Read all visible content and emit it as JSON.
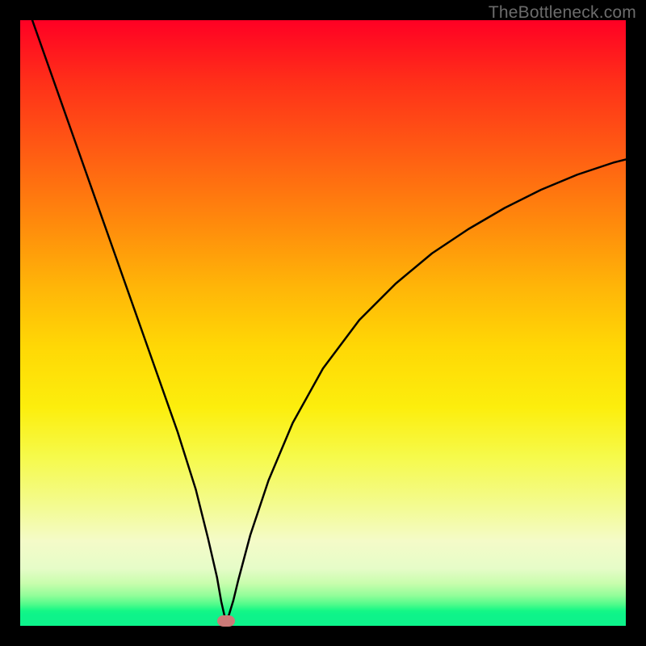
{
  "watermark": "TheBottleneck.com",
  "colors": {
    "curve_stroke": "#000000",
    "marker_fill": "#cc7a78",
    "frame_bg": "#000000"
  },
  "chart_data": {
    "type": "line",
    "title": "",
    "xlabel": "",
    "ylabel": "",
    "xlim": [
      0,
      100
    ],
    "ylim": [
      0,
      100
    ],
    "grid": false,
    "series": [
      {
        "name": "bottleneck-curve",
        "x": [
          2,
          5,
          8,
          11,
          14,
          17,
          20,
          23,
          26,
          29,
          31,
          32.5,
          33.2,
          33.7,
          34,
          34.5,
          35.2,
          36,
          38,
          41,
          45,
          50,
          56,
          62,
          68,
          74,
          80,
          86,
          92,
          98,
          100
        ],
        "y": [
          100,
          91.5,
          83,
          74.5,
          66,
          57.5,
          49,
          40.5,
          32,
          22.5,
          14.5,
          8,
          4,
          1.8,
          0.8,
          1.9,
          4.2,
          7.5,
          15,
          24,
          33.5,
          42.5,
          50.5,
          56.5,
          61.5,
          65.5,
          69,
          72,
          74.5,
          76.5,
          77
        ]
      }
    ],
    "annotations": [
      {
        "name": "minimum-marker",
        "x": 34,
        "y": 0.8
      }
    ],
    "background_gradient_stops": [
      {
        "pos": 0,
        "color": "#ff0024"
      },
      {
        "pos": 0.5,
        "color": "#ffd805"
      },
      {
        "pos": 0.86,
        "color": "#f4fbc8"
      },
      {
        "pos": 1.0,
        "color": "#0df38b"
      }
    ]
  }
}
